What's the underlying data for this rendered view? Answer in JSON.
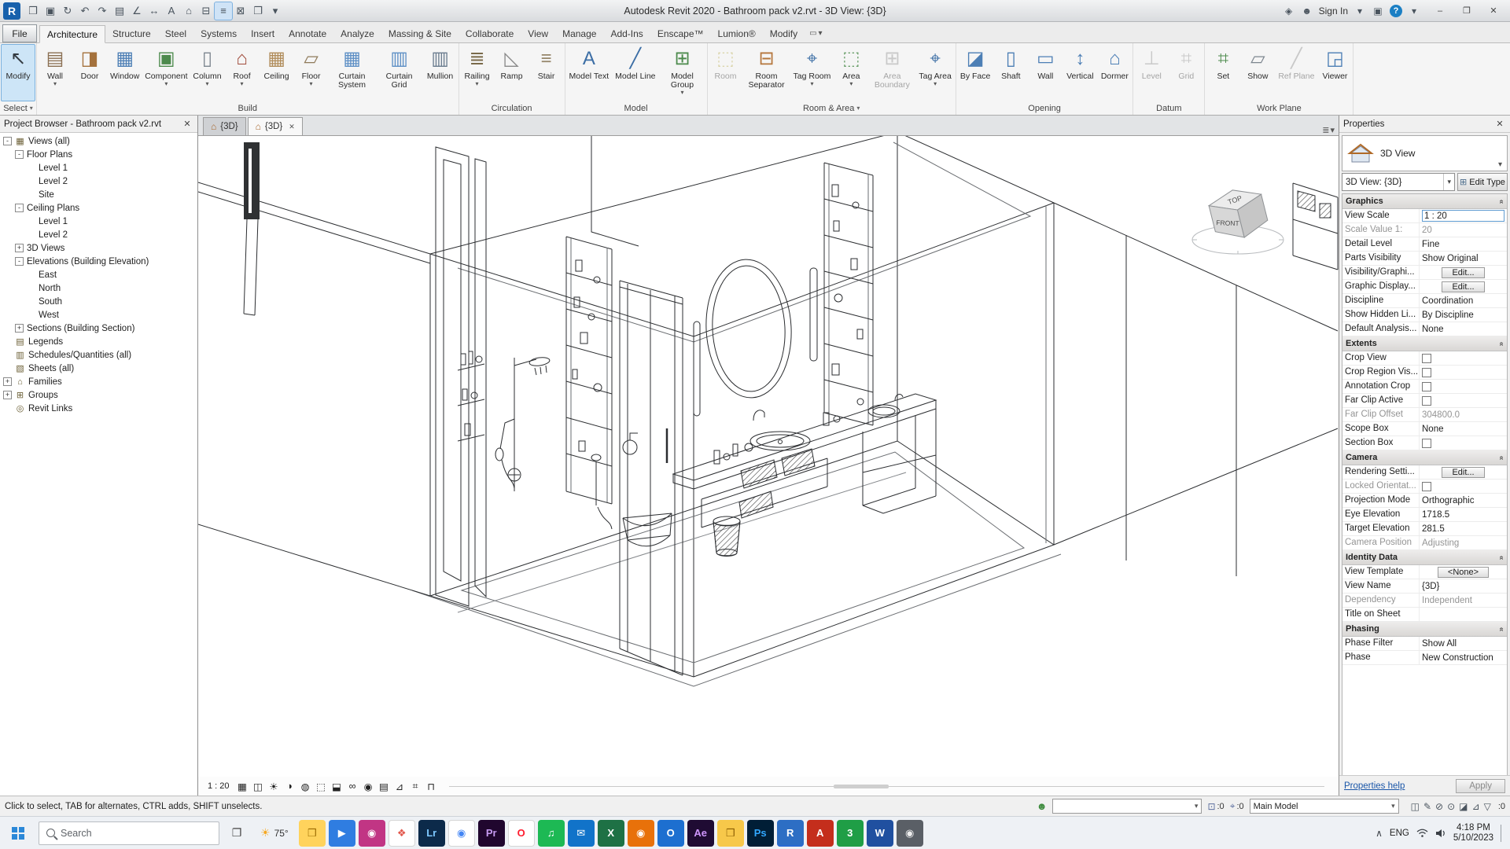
{
  "titlebar": {
    "title": "Autodesk Revit 2020 - Bathroom pack v2.rvt - 3D View: {3D}",
    "qat": [
      {
        "name": "revit-logo",
        "glyph": "R"
      },
      {
        "name": "open-icon",
        "glyph": "❒"
      },
      {
        "name": "save-icon",
        "glyph": "▣"
      },
      {
        "name": "sync-icon",
        "glyph": "↻"
      },
      {
        "name": "undo-icon",
        "glyph": "↶"
      },
      {
        "name": "redo-icon",
        "glyph": "↷"
      },
      {
        "name": "print-icon",
        "glyph": "▤"
      },
      {
        "name": "measure-icon",
        "glyph": "∠"
      },
      {
        "name": "aligned-dimension-icon",
        "glyph": "↔"
      },
      {
        "name": "text-icon",
        "glyph": "A"
      },
      {
        "name": "default-3d-view-icon",
        "glyph": "⌂"
      },
      {
        "name": "section-icon",
        "glyph": "⊟"
      },
      {
        "name": "thin-lines-icon",
        "glyph": "≡",
        "active": true
      },
      {
        "name": "close-hidden-windows-icon",
        "glyph": "⊠"
      },
      {
        "name": "switch-windows-icon",
        "glyph": "❐"
      },
      {
        "name": "qat-customize-icon",
        "glyph": "▾"
      }
    ],
    "right_items": [
      {
        "name": "communication-center-icon",
        "glyph": "◈"
      },
      {
        "name": "user-icon",
        "glyph": "☻"
      },
      {
        "name": "sign-in-label",
        "text": "Sign In"
      },
      {
        "name": "sign-in-caret-icon",
        "glyph": "▾"
      },
      {
        "name": "exchange-apps-icon",
        "glyph": "▣"
      },
      {
        "name": "help-icon",
        "glyph": "?",
        "cls": "help"
      },
      {
        "name": "help-caret-icon",
        "glyph": "▾"
      }
    ],
    "window": {
      "minimize": "–",
      "maximize": "❐",
      "close": "✕"
    }
  },
  "tabs": {
    "file": "File",
    "items": [
      "Architecture",
      "Structure",
      "Steel",
      "Systems",
      "Insert",
      "Annotate",
      "Analyze",
      "Massing & Site",
      "Collaborate",
      "View",
      "Manage",
      "Add-Ins",
      "Enscape™",
      "Lumion®",
      "Modify"
    ],
    "active": "Architecture"
  },
  "ribbon": {
    "panels": [
      {
        "title": "Select",
        "arrow": true,
        "buttons": [
          {
            "label": "Modify",
            "glyph": "↖",
            "color": "#333a41",
            "selected": true
          }
        ]
      },
      {
        "title": "Build",
        "buttons": [
          {
            "label": "Wall",
            "glyph": "▤",
            "color": "#8a6f52",
            "arrow": true
          },
          {
            "label": "Door",
            "glyph": "◨",
            "color": "#a4713c"
          },
          {
            "label": "Window",
            "glyph": "▦",
            "color": "#4d7fb5"
          },
          {
            "label": "Component",
            "glyph": "▣",
            "color": "#4c8a4c",
            "arrow": true
          },
          {
            "label": "Column",
            "glyph": "▯",
            "color": "#7d868f",
            "arrow": true
          },
          {
            "label": "Roof",
            "glyph": "⌂",
            "color": "#a04a3a",
            "arrow": true
          },
          {
            "label": "Ceiling",
            "glyph": "▦",
            "color": "#b08c5a"
          },
          {
            "label": "Floor",
            "glyph": "▱",
            "color": "#8f7a5a",
            "arrow": true
          },
          {
            "label": "Curtain System",
            "glyph": "▦",
            "color": "#5d8fc5"
          },
          {
            "label": "Curtain Grid",
            "glyph": "▥",
            "color": "#5d8fc5"
          },
          {
            "label": "Mullion",
            "glyph": "▥",
            "color": "#6a7c8e"
          }
        ]
      },
      {
        "title": "Circulation",
        "buttons": [
          {
            "label": "Railing",
            "glyph": "≣",
            "color": "#7a6a4a",
            "arrow": true
          },
          {
            "label": "Ramp",
            "glyph": "◺",
            "color": "#8a8a8a"
          },
          {
            "label": "Stair",
            "glyph": "≡",
            "color": "#96856a"
          }
        ]
      },
      {
        "title": "Model",
        "buttons": [
          {
            "label": "Model Text",
            "glyph": "A",
            "color": "#3c6ea5"
          },
          {
            "label": "Model Line",
            "glyph": "╱",
            "color": "#3c6ea5"
          },
          {
            "label": "Model Group",
            "glyph": "⊞",
            "color": "#4c8a4c",
            "arrow": true
          }
        ]
      },
      {
        "title": "Room & Area",
        "arrow": true,
        "buttons": [
          {
            "label": "Room",
            "glyph": "⬚",
            "color": "#b5a642",
            "disabled": true
          },
          {
            "label": "Room Separator",
            "glyph": "⊟",
            "color": "#b5763c"
          },
          {
            "label": "Tag Room",
            "glyph": "⌖",
            "color": "#3c6ea5",
            "arrow": true
          },
          {
            "label": "Area",
            "glyph": "⬚",
            "color": "#6ca06c",
            "arrow": true
          },
          {
            "label": "Area Boundary",
            "glyph": "⊞",
            "color": "#888888",
            "disabled": true
          },
          {
            "label": "Tag Area",
            "glyph": "⌖",
            "color": "#3c6ea5",
            "arrow": true
          }
        ]
      },
      {
        "title": "Opening",
        "buttons": [
          {
            "label": "By Face",
            "glyph": "◪",
            "color": "#4d7fb5"
          },
          {
            "label": "Shaft",
            "glyph": "▯",
            "color": "#4d7fb5"
          },
          {
            "label": "Wall",
            "glyph": "▭",
            "color": "#4d7fb5"
          },
          {
            "label": "Vertical",
            "glyph": "↕",
            "color": "#4d7fb5"
          },
          {
            "label": "Dormer",
            "glyph": "⌂",
            "color": "#4d7fb5"
          }
        ]
      },
      {
        "title": "Datum",
        "buttons": [
          {
            "label": "Level",
            "glyph": "⊥",
            "color": "#888888",
            "disabled": true
          },
          {
            "label": "Grid",
            "glyph": "⌗",
            "color": "#888888",
            "disabled": true
          }
        ]
      },
      {
        "title": "Work Plane",
        "buttons": [
          {
            "label": "Set",
            "glyph": "⌗",
            "color": "#4c8a4c"
          },
          {
            "label": "Show",
            "glyph": "▱",
            "color": "#7d868f"
          },
          {
            "label": "Ref Plane",
            "glyph": "╱",
            "color": "#888888",
            "disabled": true
          },
          {
            "label": "Viewer",
            "glyph": "◲",
            "color": "#4d7fb5"
          }
        ]
      }
    ]
  },
  "browser": {
    "header": "Project Browser - Bathroom pack v2.rvt",
    "icon_glyphs": {
      "views": "▦",
      "legends": "▤",
      "schedules": "▥",
      "sheets": "▧",
      "families": "⌂",
      "groups": "⊞",
      "links": "◎"
    },
    "tree": [
      {
        "label": "Views (all)",
        "depth": 0,
        "exp": "-",
        "icon": "views"
      },
      {
        "label": "Floor Plans",
        "depth": 1,
        "exp": "-"
      },
      {
        "label": "Level 1",
        "depth": 2
      },
      {
        "label": "Level 2",
        "depth": 2
      },
      {
        "label": "Site",
        "depth": 2
      },
      {
        "label": "Ceiling Plans",
        "depth": 1,
        "exp": "-"
      },
      {
        "label": "Level 1",
        "depth": 2
      },
      {
        "label": "Level 2",
        "depth": 2
      },
      {
        "label": "3D Views",
        "depth": 1,
        "exp": "+"
      },
      {
        "label": "Elevations (Building Elevation)",
        "depth": 1,
        "exp": "-"
      },
      {
        "label": "East",
        "depth": 2
      },
      {
        "label": "North",
        "depth": 2
      },
      {
        "label": "South",
        "depth": 2
      },
      {
        "label": "West",
        "depth": 2
      },
      {
        "label": "Sections (Building Section)",
        "depth": 1,
        "exp": "+"
      },
      {
        "label": "Legends",
        "depth": 0,
        "icon": "legends"
      },
      {
        "label": "Schedules/Quantities (all)",
        "depth": 0,
        "icon": "schedules"
      },
      {
        "label": "Sheets (all)",
        "depth": 0,
        "icon": "sheets"
      },
      {
        "label": "Families",
        "depth": 0,
        "exp": "+",
        "icon": "families"
      },
      {
        "label": "Groups",
        "depth": 0,
        "exp": "+",
        "icon": "groups"
      },
      {
        "label": "Revit Links",
        "depth": 0,
        "icon": "links"
      }
    ]
  },
  "doctabs": {
    "icon": "⌂",
    "tabs": [
      {
        "label": "{3D}"
      },
      {
        "label": "{3D}",
        "active": true,
        "closable": true
      }
    ]
  },
  "canvas": {
    "viewcube": {
      "top": "TOP",
      "front": "FRONT"
    }
  },
  "viewbar": {
    "scale": "1 : 20",
    "icons": [
      {
        "name": "detail-level-icon",
        "glyph": "▦"
      },
      {
        "name": "visual-style-icon",
        "glyph": "◫"
      },
      {
        "name": "sun-path-icon",
        "glyph": "☀"
      },
      {
        "name": "shadows-icon",
        "glyph": "◑"
      },
      {
        "name": "rendering-dialog-icon",
        "glyph": "◍"
      },
      {
        "name": "crop-view-icon",
        "glyph": "⬚"
      },
      {
        "name": "show-crop-region-icon",
        "glyph": "⬓"
      },
      {
        "name": "temporary-hide-isolate-icon",
        "glyph": "∞"
      },
      {
        "name": "reveal-hidden-elements-icon",
        "glyph": "◉"
      },
      {
        "name": "temporary-view-properties-icon",
        "glyph": "▤"
      },
      {
        "name": "show-analytical-model-icon",
        "glyph": "⊿"
      },
      {
        "name": "highlight-displacement-icon",
        "glyph": "⌗"
      },
      {
        "name": "reveal-constraints-icon",
        "glyph": "⊓"
      }
    ]
  },
  "properties": {
    "header": "Properties",
    "type_selector": {
      "category": "3D View",
      "instance": "3D View: {3D}",
      "edit_type": "Edit Type"
    },
    "sections": [
      {
        "title": "Graphics",
        "rows": [
          {
            "label": "View Scale",
            "value": "1 : 20",
            "type": "input"
          },
          {
            "label": "Scale Value    1:",
            "value": "20",
            "disabled": true
          },
          {
            "label": "Detail Level",
            "value": "Fine"
          },
          {
            "label": "Parts Visibility",
            "value": "Show Original"
          },
          {
            "label": "Visibility/Graphi...",
            "value": "Edit...",
            "type": "button"
          },
          {
            "label": "Graphic Display...",
            "value": "Edit...",
            "type": "button"
          },
          {
            "label": "Discipline",
            "value": "Coordination"
          },
          {
            "label": "Show Hidden Li...",
            "value": "By Discipline"
          },
          {
            "label": "Default Analysis...",
            "value": "None"
          }
        ]
      },
      {
        "title": "Extents",
        "rows": [
          {
            "label": "Crop View",
            "type": "checkbox"
          },
          {
            "label": "Crop Region Vis...",
            "type": "checkbox"
          },
          {
            "label": "Annotation Crop",
            "type": "checkbox"
          },
          {
            "label": "Far Clip Active",
            "type": "checkbox"
          },
          {
            "label": "Far Clip Offset",
            "value": "304800.0",
            "disabled": true
          },
          {
            "label": "Scope Box",
            "value": "None"
          },
          {
            "label": "Section Box",
            "type": "checkbox"
          }
        ]
      },
      {
        "title": "Camera",
        "rows": [
          {
            "label": "Rendering Setti...",
            "value": "Edit...",
            "type": "button"
          },
          {
            "label": "Locked Orientat...",
            "type": "checkbox",
            "disabled": true
          },
          {
            "label": "Projection Mode",
            "value": "Orthographic"
          },
          {
            "label": "Eye Elevation",
            "value": "1718.5"
          },
          {
            "label": "Target Elevation",
            "value": "281.5"
          },
          {
            "label": "Camera Position",
            "value": "Adjusting",
            "disabled": true
          }
        ]
      },
      {
        "title": "Identity Data",
        "rows": [
          {
            "label": "View Template",
            "value": "<None>",
            "type": "button"
          },
          {
            "label": "View Name",
            "value": "{3D}"
          },
          {
            "label": "Dependency",
            "value": "Independent",
            "disabled": true
          },
          {
            "label": "Title on Sheet",
            "value": ""
          }
        ]
      },
      {
        "title": "Phasing",
        "rows": [
          {
            "label": "Phase Filter",
            "value": "Show All"
          },
          {
            "label": "Phase",
            "value": "New Construction"
          }
        ]
      }
    ],
    "footer": {
      "help": "Properties help",
      "apply": "Apply"
    }
  },
  "statusbar": {
    "hint": "Click to select, TAB for alternates, CTRL adds, SHIFT unselects.",
    "counters": [
      {
        "name": "design-options-indicator",
        "glyph": "⊡",
        "text": ":0"
      },
      {
        "name": "selection-count-indicator",
        "glyph": "⌖",
        "text": ":0"
      }
    ],
    "main_model": "Main Model",
    "right_icons": [
      {
        "name": "worksharing-display-icon",
        "glyph": "◫"
      },
      {
        "name": "editable-only-icon",
        "glyph": "✎"
      },
      {
        "name": "select-links-icon",
        "glyph": "⊘"
      },
      {
        "name": "select-pinned-icon",
        "glyph": "⊙"
      },
      {
        "name": "select-by-face-icon",
        "glyph": "◪"
      },
      {
        "name": "drag-on-selection-icon",
        "glyph": "⊿"
      },
      {
        "name": "filter-icon",
        "glyph": "▽"
      }
    ],
    "filter_count": ":0"
  },
  "taskbar": {
    "search_placeholder": "Search",
    "weather": "75°",
    "apps": [
      {
        "name": "file-explorer",
        "glyph": "❒",
        "bg": "#ffd35c",
        "fg": "#9a6b00"
      },
      {
        "name": "facetime",
        "glyph": "▶",
        "bg": "#2f7de1",
        "fg": "#ffffff"
      },
      {
        "name": "instagram",
        "glyph": "◉",
        "bg": "#c13584",
        "fg": "#ffffff"
      },
      {
        "name": "photos",
        "glyph": "❖",
        "bg": "#ffffff",
        "fg": "#e2574c"
      },
      {
        "name": "lightroom",
        "glyph": "Lr",
        "bg": "#0c2a4a",
        "fg": "#7ec8ff"
      },
      {
        "name": "chrome",
        "glyph": "◉",
        "bg": "#ffffff",
        "fg": "#4285f4"
      },
      {
        "name": "premiere",
        "glyph": "Pr",
        "bg": "#20062e",
        "fg": "#c79bf2"
      },
      {
        "name": "opera",
        "glyph": "O",
        "bg": "#ffffff",
        "fg": "#ff1b2d"
      },
      {
        "name": "spotify",
        "glyph": "♫",
        "bg": "#1db954",
        "fg": "#ffffff"
      },
      {
        "name": "mail",
        "glyph": "✉",
        "bg": "#1173c9",
        "fg": "#ffffff"
      },
      {
        "name": "excel",
        "glyph": "X",
        "bg": "#1e7145",
        "fg": "#ffffff"
      },
      {
        "name": "brave",
        "glyph": "◉",
        "bg": "#e8710a",
        "fg": "#ffffff"
      },
      {
        "name": "outlook",
        "glyph": "O",
        "bg": "#1d6fd0",
        "fg": "#ffffff"
      },
      {
        "name": "after-effects",
        "glyph": "Ae",
        "bg": "#1f0b33",
        "fg": "#cf96fd"
      },
      {
        "name": "folder",
        "glyph": "❒",
        "bg": "#f7c84a",
        "fg": "#8a5d00"
      },
      {
        "name": "photoshop",
        "glyph": "Ps",
        "bg": "#001e36",
        "fg": "#31a8ff"
      },
      {
        "name": "revit",
        "glyph": "R",
        "bg": "#2e6fc2",
        "fg": "#ffffff",
        "active": true
      },
      {
        "name": "autocad",
        "glyph": "A",
        "bg": "#c42e1c",
        "fg": "#ffffff"
      },
      {
        "name": "3ds-max",
        "glyph": "3",
        "bg": "#1f9e46",
        "fg": "#ffffff"
      },
      {
        "name": "word",
        "glyph": "W",
        "bg": "#2050a0",
        "fg": "#ffffff"
      },
      {
        "name": "camera",
        "glyph": "◉",
        "bg": "#5a5f66",
        "fg": "#eeeeee"
      }
    ],
    "tray": {
      "lang": "ENG",
      "time": "4:18 PM",
      "date": "5/10/2023"
    }
  }
}
